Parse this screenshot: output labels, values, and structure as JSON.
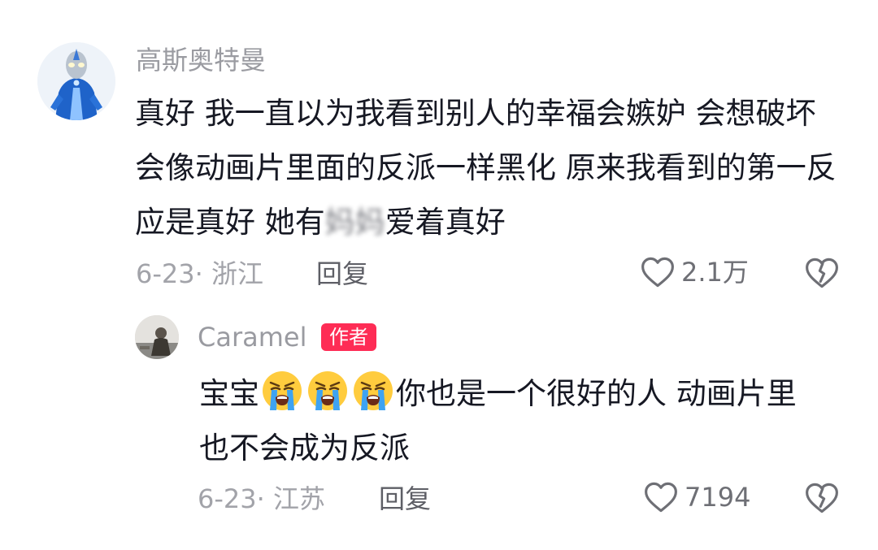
{
  "comments": [
    {
      "username": "高斯奥特曼",
      "avatar_icon": "ultraman-avatar",
      "text_parts": {
        "before": "真好 我一直以为我看到别人的幸福会嫉妒 会想破坏 会像动画片里面的反派一样黑化 原来我看到的第一反应是真好 她有",
        "blurred": "妈妈",
        "after": "爱着真好"
      },
      "date_location": "6-23· 浙江",
      "reply_label": "回复",
      "like_count": "2.1万"
    },
    {
      "username": "Caramel",
      "avatar_icon": "person-photo-avatar",
      "badge": "作者",
      "text_parts": {
        "prefix": "宝宝",
        "emojis": [
          "loudly-crying-face-emoji",
          "loudly-crying-face-emoji",
          "loudly-crying-face-emoji"
        ],
        "suffix": "你也是一个很好的人 动画片里也不会成为反派"
      },
      "date_location": "6-23· 江苏",
      "reply_label": "回复",
      "like_count": "7194"
    }
  ],
  "colors": {
    "badge_bg": "#fe2c55",
    "text_primary": "#161823",
    "text_secondary": "#9a9ba1"
  }
}
